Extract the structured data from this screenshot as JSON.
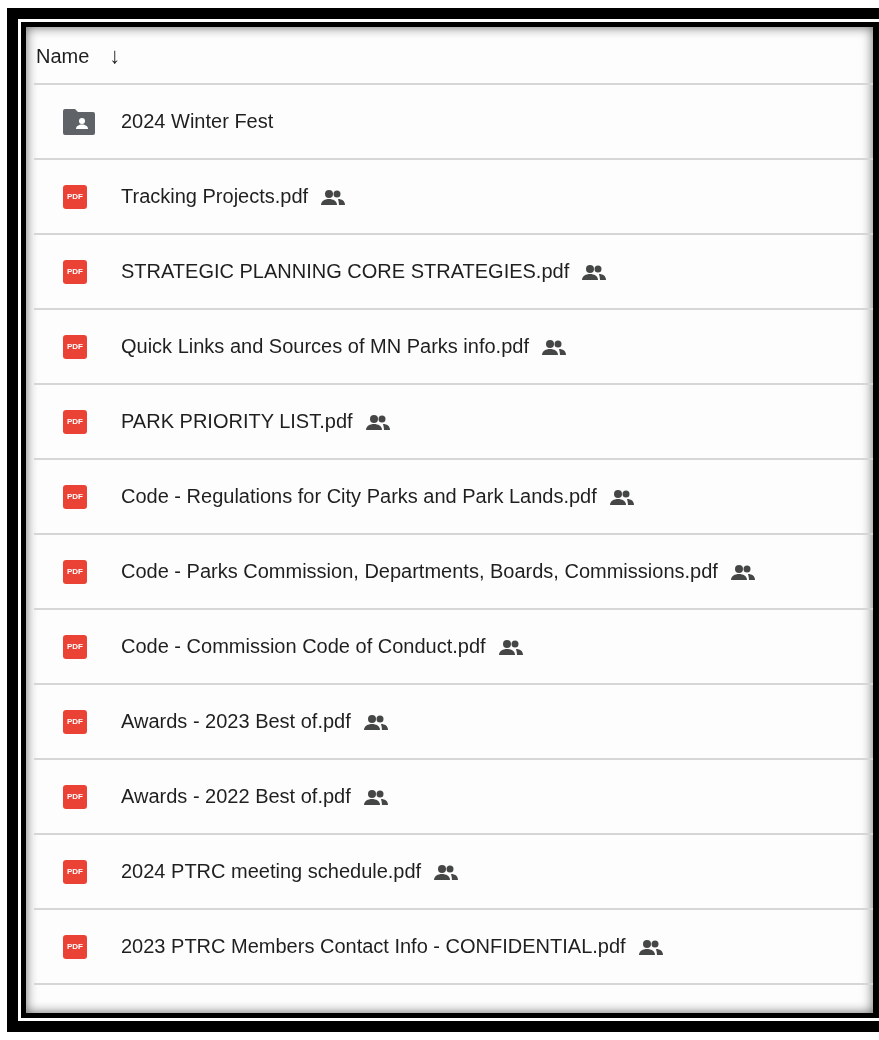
{
  "header": {
    "label": "Name",
    "sort_icon": "↓"
  },
  "files": [
    {
      "kind": "folder",
      "name": "2024 Winter Fest",
      "shared": false
    },
    {
      "kind": "pdf",
      "icon_label": "PDF",
      "name": "Tracking Projects.pdf",
      "shared": true
    },
    {
      "kind": "pdf",
      "icon_label": "PDF",
      "name": "STRATEGIC PLANNING CORE STRATEGIES.pdf",
      "shared": true
    },
    {
      "kind": "pdf",
      "icon_label": "PDF",
      "name": "Quick Links and Sources of MN Parks info.pdf",
      "shared": true
    },
    {
      "kind": "pdf",
      "icon_label": "PDF",
      "name": "PARK PRIORITY LIST.pdf",
      "shared": true
    },
    {
      "kind": "pdf",
      "icon_label": "PDF",
      "name": "Code - Regulations for City Parks and Park Lands.pdf",
      "shared": true
    },
    {
      "kind": "pdf",
      "icon_label": "PDF",
      "name": "Code - Parks Commission, Departments, Boards, Commissions.pdf",
      "shared": true
    },
    {
      "kind": "pdf",
      "icon_label": "PDF",
      "name": "Code - Commission Code of Conduct.pdf",
      "shared": true
    },
    {
      "kind": "pdf",
      "icon_label": "PDF",
      "name": "Awards - 2023 Best of.pdf",
      "shared": true
    },
    {
      "kind": "pdf",
      "icon_label": "PDF",
      "name": "Awards - 2022 Best of.pdf",
      "shared": true
    },
    {
      "kind": "pdf",
      "icon_label": "PDF",
      "name": "2024 PTRC meeting schedule.pdf",
      "shared": true
    },
    {
      "kind": "pdf",
      "icon_label": "PDF",
      "name": "2023 PTRC Members Contact Info - CONFIDENTIAL.pdf",
      "shared": true
    }
  ]
}
